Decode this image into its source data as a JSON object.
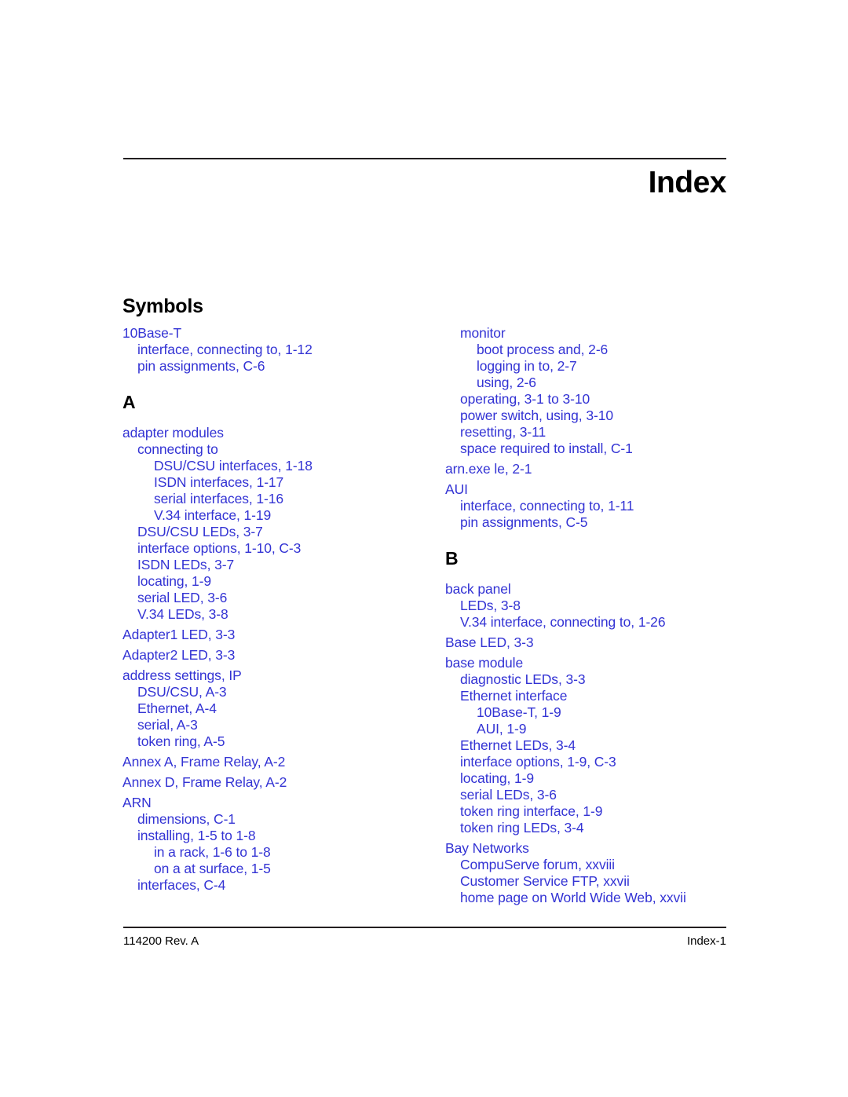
{
  "document": {
    "page_title": "Index",
    "section_heading": "Symbols",
    "text_color": "#3333d4",
    "heading_color": "#000000"
  },
  "footer": {
    "left": "114200 Rev. A",
    "right": "Index-1"
  },
  "columns": {
    "left": [
      {
        "type": "group",
        "entries": [
          {
            "level": 0,
            "text": "10Base-T"
          },
          {
            "level": 1,
            "text": "interface, connecting to, 1-12"
          },
          {
            "level": 1,
            "text": "pin assignments, C-6"
          }
        ]
      },
      {
        "type": "letter",
        "label": "A"
      },
      {
        "type": "group",
        "entries": [
          {
            "level": 0,
            "text": "adapter modules"
          },
          {
            "level": 1,
            "text": "connecting to"
          },
          {
            "level": 2,
            "text": "DSU/CSU interfaces, 1-18"
          },
          {
            "level": 2,
            "text": "ISDN interfaces, 1-17"
          },
          {
            "level": 2,
            "text": "serial interfaces, 1-16"
          },
          {
            "level": 2,
            "text": "V.34 interface, 1-19"
          },
          {
            "level": 1,
            "text": "DSU/CSU LEDs, 3-7"
          },
          {
            "level": 1,
            "text": "interface options, 1-10, C-3"
          },
          {
            "level": 1,
            "text": "ISDN LEDs, 3-7"
          },
          {
            "level": 1,
            "text": "locating, 1-9"
          },
          {
            "level": 1,
            "text": "serial LED, 3-6"
          },
          {
            "level": 1,
            "text": "V.34 LEDs, 3-8"
          }
        ]
      },
      {
        "type": "group",
        "entries": [
          {
            "level": 0,
            "text": "Adapter1 LED, 3-3"
          }
        ]
      },
      {
        "type": "group",
        "entries": [
          {
            "level": 0,
            "text": "Adapter2 LED, 3-3"
          }
        ]
      },
      {
        "type": "group",
        "entries": [
          {
            "level": 0,
            "text": "address settings, IP"
          },
          {
            "level": 1,
            "text": "DSU/CSU, A-3"
          },
          {
            "level": 1,
            "text": "Ethernet, A-4"
          },
          {
            "level": 1,
            "text": "serial, A-3"
          },
          {
            "level": 1,
            "text": "token ring, A-5"
          }
        ]
      },
      {
        "type": "group",
        "entries": [
          {
            "level": 0,
            "text": "Annex A, Frame Relay, A-2"
          }
        ]
      },
      {
        "type": "group",
        "entries": [
          {
            "level": 0,
            "text": "Annex D, Frame Relay, A-2"
          }
        ]
      },
      {
        "type": "group",
        "entries": [
          {
            "level": 0,
            "text": "ARN"
          },
          {
            "level": 1,
            "text": "dimensions, C-1"
          },
          {
            "level": 1,
            "text": "installing, 1-5 to 1-8"
          },
          {
            "level": 2,
            "text": "in a rack, 1-6 to 1-8"
          },
          {
            "level": 2,
            "text": "on a  at surface, 1-5"
          },
          {
            "level": 1,
            "text": "interfaces, C-4"
          }
        ]
      }
    ],
    "right": [
      {
        "type": "group",
        "entries": [
          {
            "level": 1,
            "text": "monitor"
          },
          {
            "level": 2,
            "text": "boot process and, 2-6"
          },
          {
            "level": 2,
            "text": "logging in to, 2-7"
          },
          {
            "level": 2,
            "text": "using, 2-6"
          },
          {
            "level": 1,
            "text": "operating, 3-1 to 3-10"
          },
          {
            "level": 1,
            "text": "power switch, using, 3-10"
          },
          {
            "level": 1,
            "text": "resetting, 3-11"
          },
          {
            "level": 1,
            "text": "space required to install, C-1"
          }
        ]
      },
      {
        "type": "group",
        "entries": [
          {
            "level": 0,
            "text": "arn.exe  le, 2-1"
          }
        ]
      },
      {
        "type": "group",
        "entries": [
          {
            "level": 0,
            "text": "AUI"
          },
          {
            "level": 1,
            "text": "interface, connecting to, 1-11"
          },
          {
            "level": 1,
            "text": "pin assignments, C-5"
          }
        ]
      },
      {
        "type": "letter",
        "label": "B"
      },
      {
        "type": "group",
        "entries": [
          {
            "level": 0,
            "text": "back panel"
          },
          {
            "level": 1,
            "text": "LEDs, 3-8"
          },
          {
            "level": 1,
            "text": "V.34 interface, connecting to, 1-26"
          }
        ]
      },
      {
        "type": "group",
        "entries": [
          {
            "level": 0,
            "text": "Base LED, 3-3"
          }
        ]
      },
      {
        "type": "group",
        "entries": [
          {
            "level": 0,
            "text": "base module"
          },
          {
            "level": 1,
            "text": "diagnostic LEDs, 3-3"
          },
          {
            "level": 1,
            "text": "Ethernet interface"
          },
          {
            "level": 2,
            "text": "10Base-T, 1-9"
          },
          {
            "level": 2,
            "text": "AUI, 1-9"
          },
          {
            "level": 1,
            "text": "Ethernet LEDs, 3-4"
          },
          {
            "level": 1,
            "text": "interface options, 1-9, C-3"
          },
          {
            "level": 1,
            "text": "locating, 1-9"
          },
          {
            "level": 1,
            "text": "serial LEDs, 3-6"
          },
          {
            "level": 1,
            "text": "token ring interface, 1-9"
          },
          {
            "level": 1,
            "text": "token ring LEDs, 3-4"
          }
        ]
      },
      {
        "type": "group",
        "entries": [
          {
            "level": 0,
            "text": "Bay Networks"
          },
          {
            "level": 1,
            "text": "CompuServe forum, xxviii"
          },
          {
            "level": 1,
            "text": "Customer Service FTP, xxvii"
          },
          {
            "level": 1,
            "text": "home page on World Wide Web, xxvii"
          }
        ]
      }
    ]
  }
}
